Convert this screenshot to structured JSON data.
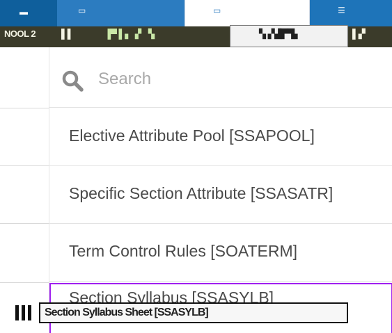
{
  "toolbar": {
    "items": [
      {
        "text": "NOOL 2"
      },
      {
        "text": "▌▌"
      },
      {
        "text": "▐▀ ▌▖▗▘▝▖"
      },
      {
        "text": "▚ ▞▟▛▜▖"
      },
      {
        "text": "▌▞"
      }
    ],
    "colors": {
      "blue": "#1a73b8",
      "dark": "#3b3b2a"
    }
  },
  "search": {
    "icon": "search-icon",
    "placeholder": "Search",
    "value": ""
  },
  "menu": {
    "items": [
      {
        "label": "Elective Attribute Pool [SSAPOOL]"
      },
      {
        "label": "Specific Section Attribute [SSASATR]"
      },
      {
        "label": "Term Control Rules [SOATERM]"
      },
      {
        "label": "Section Syllabus [SSASYLB]"
      }
    ],
    "highlight_color": "#a020f0"
  },
  "overlay": {
    "text": "Section Syllabus Sheet [SSASYLB]"
  }
}
